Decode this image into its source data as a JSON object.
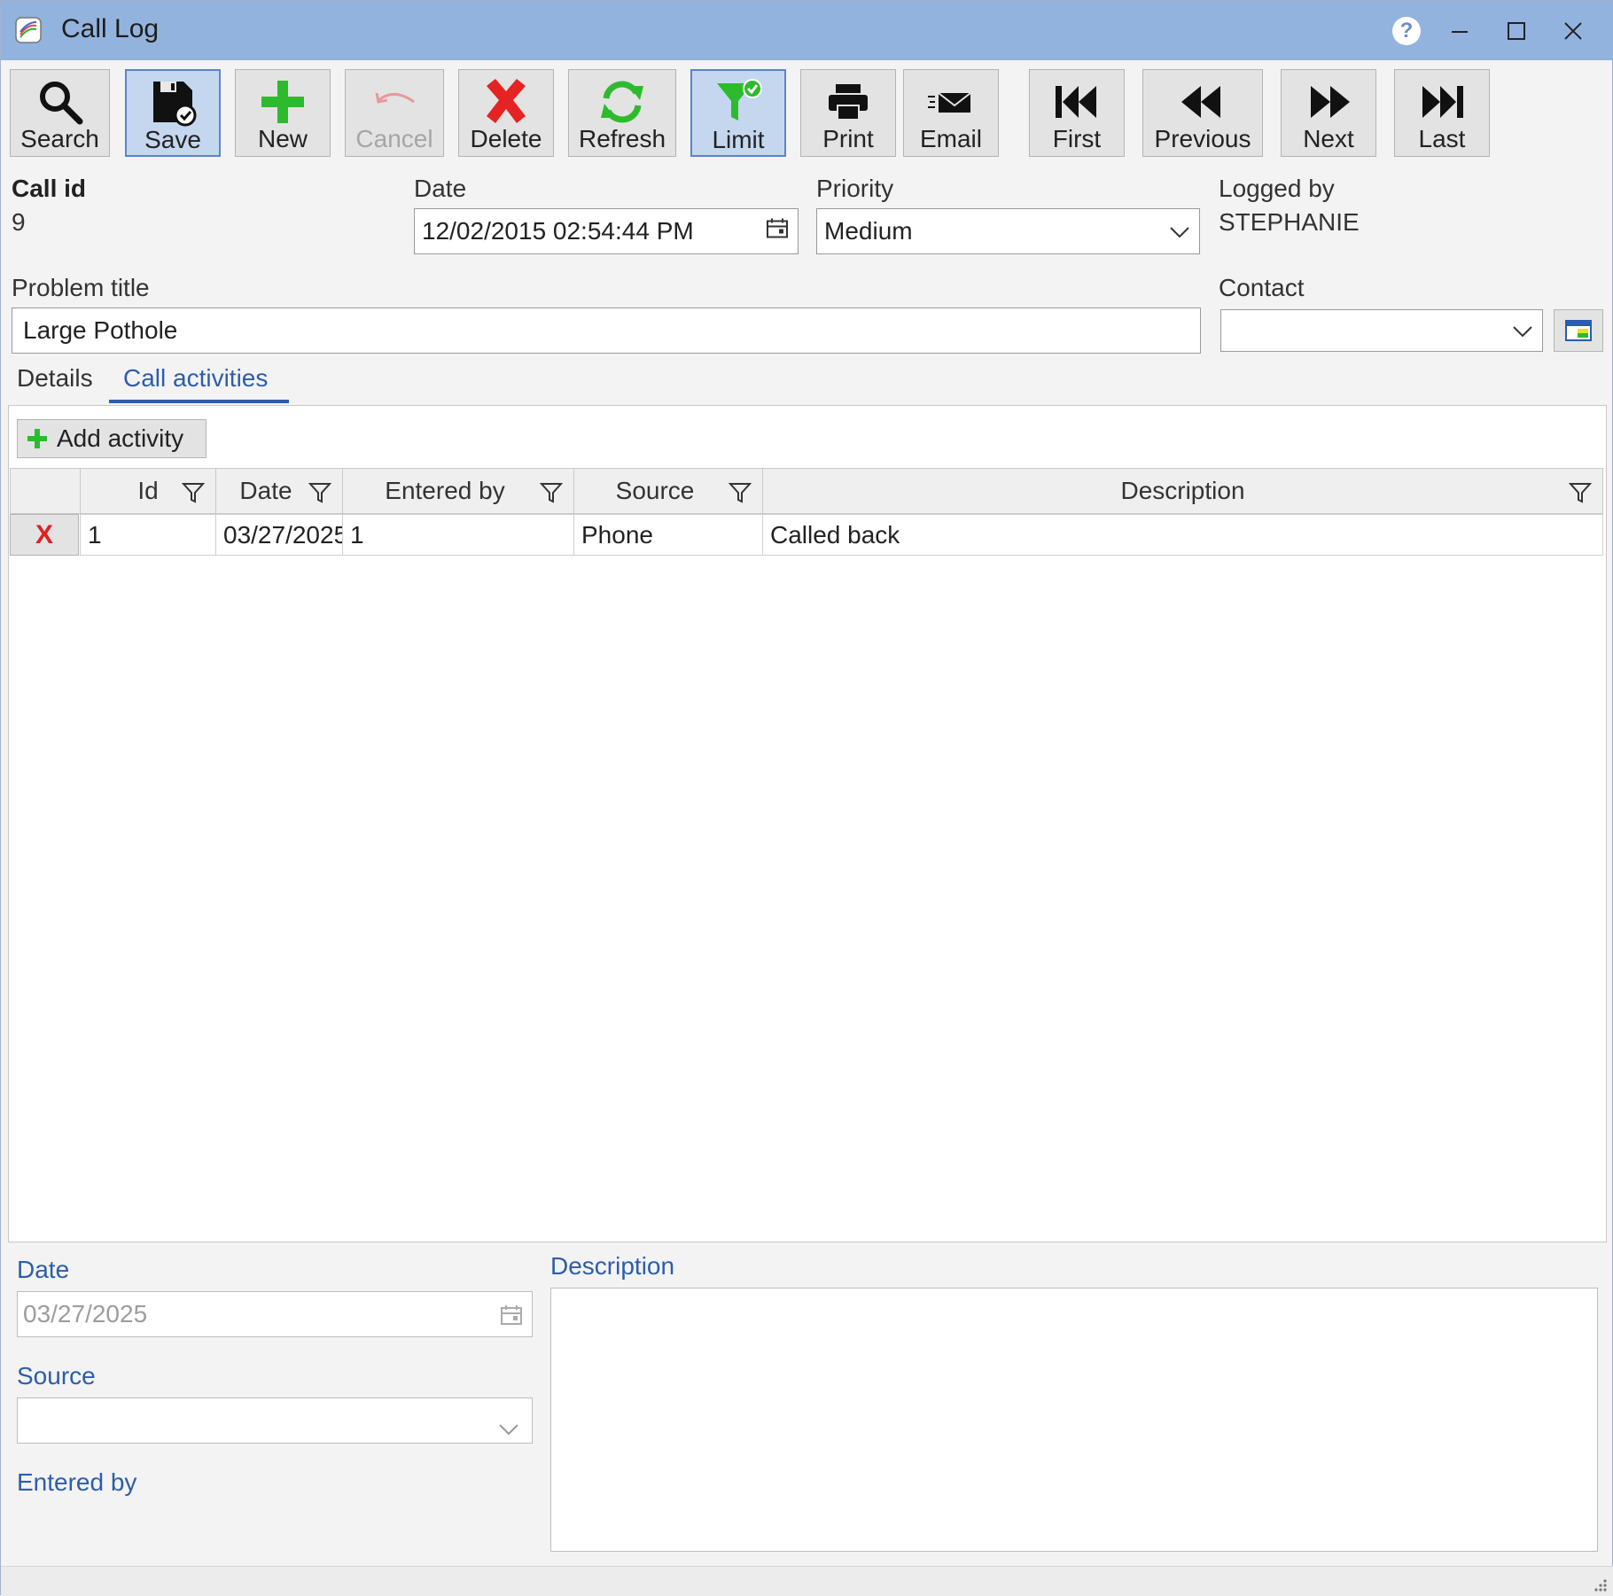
{
  "window": {
    "title": "Call Log"
  },
  "toolbar": [
    {
      "key": "search",
      "label": "Search",
      "icon": "search-icon",
      "state": "normal"
    },
    {
      "key": "save",
      "label": "Save",
      "icon": "save-icon",
      "state": "active"
    },
    {
      "key": "new",
      "label": "New",
      "icon": "plus-icon",
      "state": "normal"
    },
    {
      "key": "cancel",
      "label": "Cancel",
      "icon": "undo-icon",
      "state": "disabled"
    },
    {
      "key": "delete",
      "label": "Delete",
      "icon": "x-icon",
      "state": "normal"
    },
    {
      "key": "refresh",
      "label": "Refresh",
      "icon": "refresh-icon",
      "state": "normal"
    },
    {
      "key": "limit",
      "label": "Limit",
      "icon": "filter-check-icon",
      "state": "active"
    },
    {
      "key": "print",
      "label": "Print",
      "icon": "printer-icon",
      "state": "normal"
    },
    {
      "key": "email",
      "label": "Email",
      "icon": "envelope-icon",
      "state": "normal"
    },
    {
      "key": "first",
      "label": "First",
      "icon": "first-icon",
      "state": "normal"
    },
    {
      "key": "previous",
      "label": "Previous",
      "icon": "previous-icon",
      "state": "normal"
    },
    {
      "key": "next",
      "label": "Next",
      "icon": "next-icon",
      "state": "normal"
    },
    {
      "key": "last",
      "label": "Last",
      "icon": "last-icon",
      "state": "normal"
    }
  ],
  "header": {
    "call_id_label": "Call id",
    "call_id_value": "9",
    "date_label": "Date",
    "date_value": "12/02/2015 02:54:44 PM",
    "priority_label": "Priority",
    "priority_value": "Medium",
    "logged_by_label": "Logged by",
    "logged_by_value": "STEPHANIE",
    "problem_title_label": "Problem title",
    "problem_title_value": "Large Pothole",
    "contact_label": "Contact",
    "contact_value": ""
  },
  "tabs": [
    {
      "label": "Details",
      "active": false
    },
    {
      "label": "Call activities",
      "active": true
    }
  ],
  "activities": {
    "add_label": "Add activity",
    "columns": [
      "Id",
      "Date",
      "Entered by",
      "Source",
      "Description"
    ],
    "rows": [
      {
        "delete": "X",
        "id": "1",
        "date": "03/27/2025",
        "entered_by": "1",
        "source": "Phone",
        "description": "Called back"
      }
    ]
  },
  "detail": {
    "date_label": "Date",
    "date_value": "03/27/2025",
    "source_label": "Source",
    "source_value": "",
    "entered_by_label": "Entered by",
    "description_label": "Description",
    "description_value": ""
  },
  "colors": {
    "titlebar": "#93b3df",
    "accent_blue": "#2d5ea8",
    "active_button": "#c5d7ef",
    "green": "#2dbb2d",
    "red": "#e02020"
  }
}
